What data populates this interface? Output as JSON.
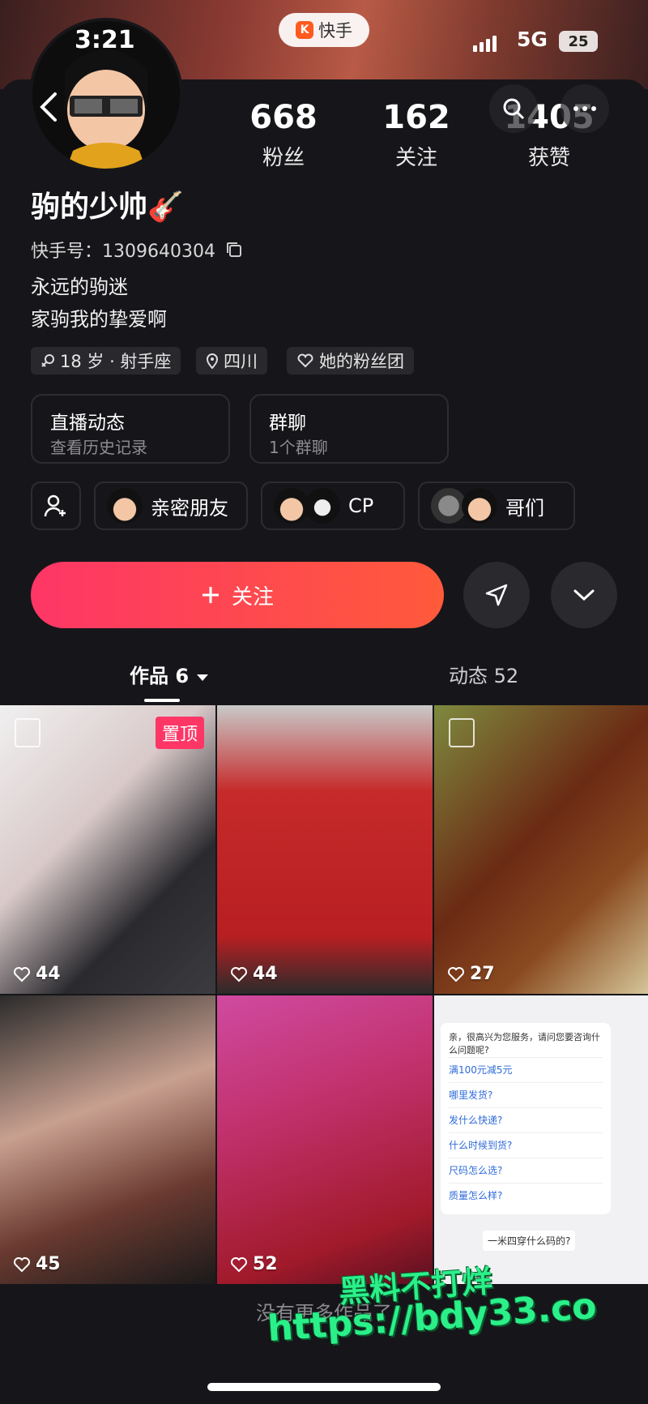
{
  "status_bar": {
    "time": "3:21",
    "app_name": "快手",
    "network": "5G",
    "battery": "25"
  },
  "profile": {
    "name": "驹的少帅🎸",
    "kuaishou_id": "快手号：1309640304",
    "bio_lines": [
      "永远的驹迷",
      "家驹我的挚爱啊"
    ],
    "stats": [
      {
        "value": "668",
        "label": "粉丝"
      },
      {
        "value": "162",
        "label": "关注"
      },
      {
        "value": "1405",
        "label": "获赞"
      }
    ],
    "tags": [
      "18 岁 · 射手座",
      "四川",
      "她的粉丝团"
    ]
  },
  "cards": [
    {
      "title": "直播动态",
      "subtitle": "查看历史记录"
    },
    {
      "title": "群聊",
      "subtitle": "1个群聊"
    }
  ],
  "friends": [
    {
      "label": "亲密朋友"
    },
    {
      "label": "CP"
    },
    {
      "label": "哥们"
    }
  ],
  "actions": {
    "follow_label": "关注"
  },
  "tabs": [
    {
      "label": "作品 6"
    },
    {
      "label": "动态 52"
    }
  ],
  "posts": [
    {
      "likes": "44",
      "badge": "置顶"
    },
    {
      "likes": "44"
    },
    {
      "likes": "27"
    },
    {
      "likes": "45"
    },
    {
      "likes": "52"
    },
    {
      "likes": ""
    }
  ],
  "chat_preview": {
    "greeting": "亲，很高兴为您服务，请问您要咨询什么问题呢?",
    "options": [
      "满100元减5元",
      "哪里发货?",
      "发什么快递?",
      "什么时候到货?",
      "尺码怎么选?",
      "质量怎么样?"
    ],
    "question": "一米四穿什么码的?"
  },
  "footer_text": "没有更多作品了",
  "watermark": {
    "line1": "黑料不打烊",
    "line2": "https://bdy33.co"
  },
  "colors": {
    "accent": "#fe3666",
    "background": "#16161a"
  }
}
